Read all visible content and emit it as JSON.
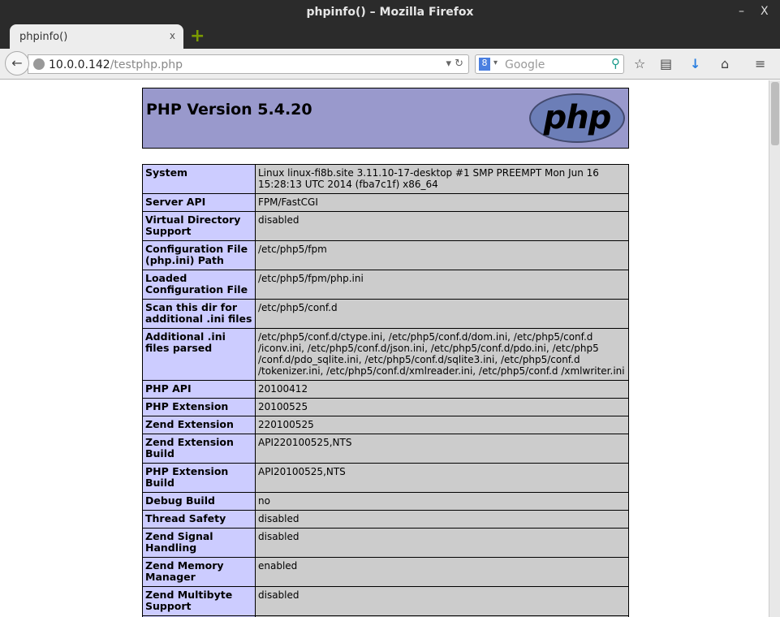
{
  "window": {
    "title": "phpinfo() – Mozilla Firefox",
    "minimize": "–",
    "close": "X"
  },
  "tab": {
    "label": "phpinfo()",
    "close": "x",
    "new_tab": "+"
  },
  "nav": {
    "url_host": "10.0.0.142",
    "url_path": "/testphp.php",
    "search_placeholder": "Google",
    "search_engine": "8"
  },
  "header": {
    "title": "PHP Version 5.4.20",
    "logo": "php"
  },
  "rows": [
    {
      "k": "System",
      "v": "Linux linux-fi8b.site 3.11.10-17-desktop #1 SMP PREEMPT Mon Jun 16 15:28:13 UTC 2014 (fba7c1f) x86_64"
    },
    {
      "k": "Server API",
      "v": "FPM/FastCGI"
    },
    {
      "k": "Virtual Directory Support",
      "v": "disabled"
    },
    {
      "k": "Configuration File (php.ini) Path",
      "v": "/etc/php5/fpm"
    },
    {
      "k": "Loaded Configuration File",
      "v": "/etc/php5/fpm/php.ini"
    },
    {
      "k": "Scan this dir for additional .ini files",
      "v": "/etc/php5/conf.d"
    },
    {
      "k": "Additional .ini files parsed",
      "v": "/etc/php5/conf.d/ctype.ini, /etc/php5/conf.d/dom.ini, /etc/php5/conf.d /iconv.ini, /etc/php5/conf.d/json.ini, /etc/php5/conf.d/pdo.ini, /etc/php5 /conf.d/pdo_sqlite.ini, /etc/php5/conf.d/sqlite3.ini, /etc/php5/conf.d /tokenizer.ini, /etc/php5/conf.d/xmlreader.ini, /etc/php5/conf.d /xmlwriter.ini"
    },
    {
      "k": "PHP API",
      "v": "20100412"
    },
    {
      "k": "PHP Extension",
      "v": "20100525"
    },
    {
      "k": "Zend Extension",
      "v": "220100525"
    },
    {
      "k": "Zend Extension Build",
      "v": "API220100525,NTS"
    },
    {
      "k": "PHP Extension Build",
      "v": "API20100525,NTS"
    },
    {
      "k": "Debug Build",
      "v": "no"
    },
    {
      "k": "Thread Safety",
      "v": "disabled"
    },
    {
      "k": "Zend Signal Handling",
      "v": "disabled"
    },
    {
      "k": "Zend Memory Manager",
      "v": "enabled"
    },
    {
      "k": "Zend Multibyte Support",
      "v": "disabled"
    },
    {
      "k": "",
      "v": ""
    }
  ]
}
